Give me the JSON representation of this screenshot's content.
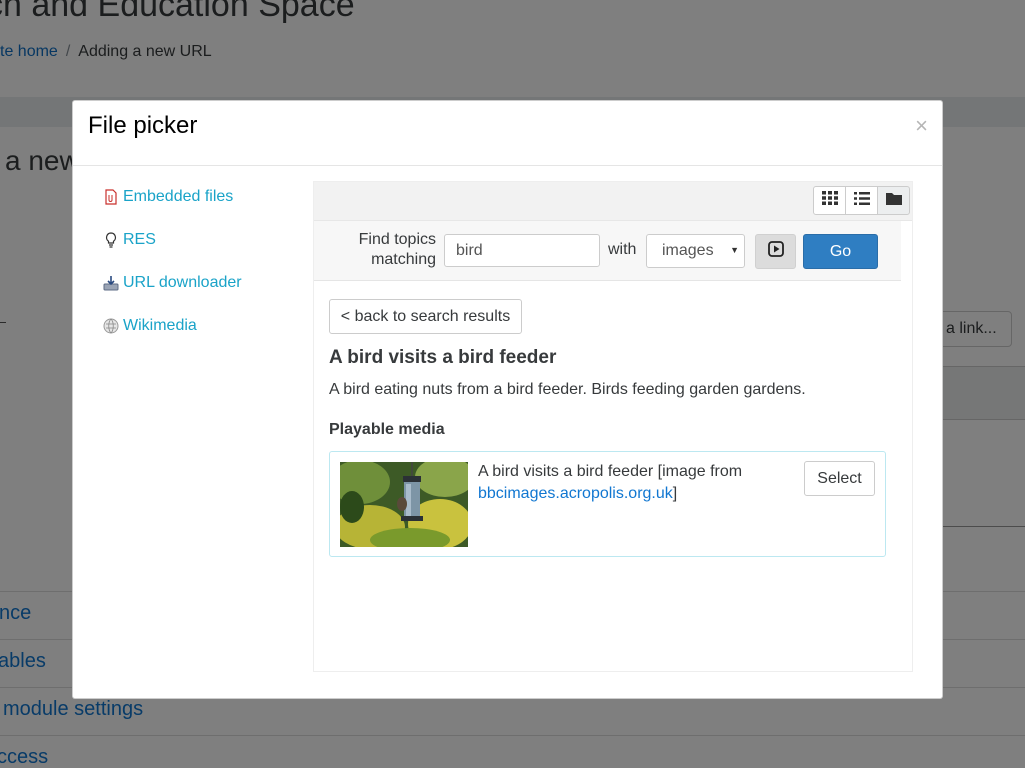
{
  "background": {
    "page_title": "ch and Education Space",
    "breadcrumb": {
      "home": "te home",
      "separator": "/",
      "current": "Adding a new URL"
    },
    "heading": "a new",
    "link_button": "a link...",
    "sections": [
      "nce",
      "ables",
      "module settings",
      "ccess"
    ]
  },
  "modal": {
    "title": "File picker",
    "close_label": "×",
    "nav": [
      {
        "label": "Embedded files",
        "icon": "file-icon"
      },
      {
        "label": "RES",
        "icon": "lightbulb-icon"
      },
      {
        "label": "URL downloader",
        "icon": "download-icon"
      },
      {
        "label": "Wikimedia",
        "icon": "wikimedia-globe-icon"
      }
    ],
    "toolbar": {
      "views": [
        "grid-view-icon",
        "list-view-icon",
        "folder-view-icon"
      ]
    },
    "search": {
      "find_label": "Find topics matching",
      "query": "bird",
      "with_label": "with",
      "media_type": "images",
      "go_label": "Go"
    },
    "results": {
      "back_label": "< back to search results",
      "title": "A bird visits a bird feeder",
      "description": "A bird eating nuts from a bird feeder. Birds feeding garden gardens.",
      "playable_heading": "Playable media",
      "item": {
        "caption_prefix": "A bird visits a bird feeder [image from",
        "source_site": "bbcimages.acropolis.org.uk",
        "caption_suffix": "]",
        "select_label": "Select"
      }
    }
  },
  "colors": {
    "accent": "#1aa3c8",
    "primary_button": "#2f7ec2",
    "card_border": "#bce8f1"
  }
}
